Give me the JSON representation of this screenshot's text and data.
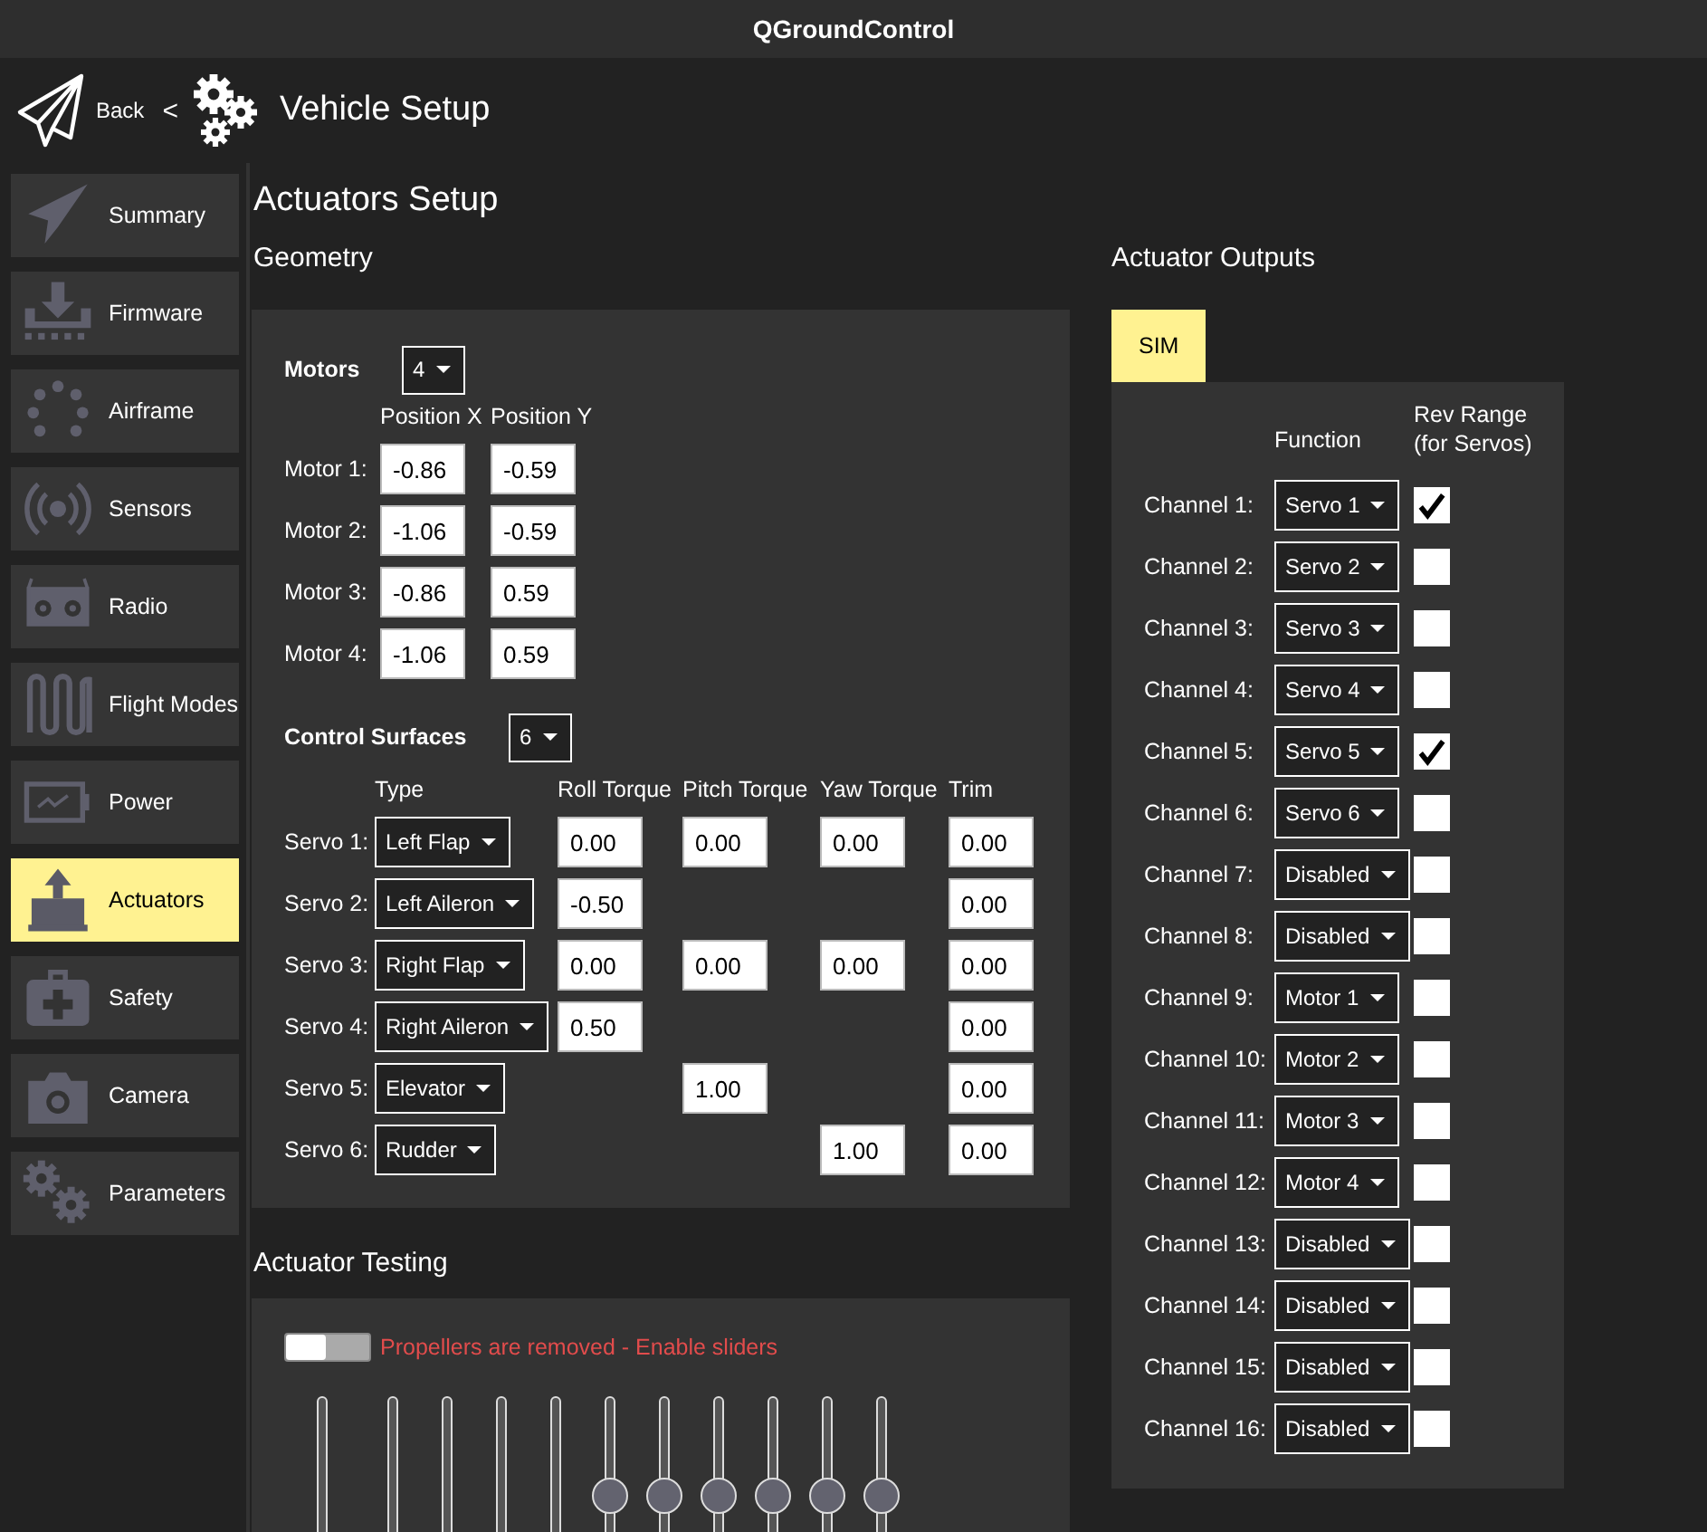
{
  "window": {
    "title": "QGroundControl"
  },
  "header": {
    "back": "Back",
    "separator": "<",
    "title": "Vehicle Setup"
  },
  "sidebar": {
    "items": [
      {
        "label": "Summary",
        "selected": false
      },
      {
        "label": "Firmware",
        "selected": false
      },
      {
        "label": "Airframe",
        "selected": false
      },
      {
        "label": "Sensors",
        "selected": false
      },
      {
        "label": "Radio",
        "selected": false
      },
      {
        "label": "Flight Modes",
        "selected": false
      },
      {
        "label": "Power",
        "selected": false
      },
      {
        "label": "Actuators",
        "selected": true
      },
      {
        "label": "Safety",
        "selected": false
      },
      {
        "label": "Camera",
        "selected": false
      },
      {
        "label": "Parameters",
        "selected": false
      }
    ]
  },
  "page_title": "Actuators Setup",
  "geometry": {
    "title": "Geometry",
    "motors": {
      "label": "Motors",
      "count": "4",
      "columns": [
        "Position X",
        "Position Y"
      ],
      "rows": [
        {
          "label": "Motor 1:",
          "values": [
            "-0.86",
            "-0.59"
          ]
        },
        {
          "label": "Motor 2:",
          "values": [
            "-1.06",
            "-0.59"
          ]
        },
        {
          "label": "Motor 3:",
          "values": [
            "-0.86",
            "0.59"
          ]
        },
        {
          "label": "Motor 4:",
          "values": [
            "-1.06",
            "0.59"
          ]
        }
      ]
    },
    "control_surfaces": {
      "label": "Control Surfaces",
      "count": "6",
      "columns": [
        "Type",
        "Roll Torque",
        "Pitch Torque",
        "Yaw Torque",
        "Trim"
      ],
      "rows": [
        {
          "label": "Servo 1:",
          "type": "Left Flap",
          "roll": "0.00",
          "pitch": "0.00",
          "yaw": "0.00",
          "trim": "0.00"
        },
        {
          "label": "Servo 2:",
          "type": "Left Aileron",
          "roll": "-0.50",
          "trim": "0.00"
        },
        {
          "label": "Servo 3:",
          "type": "Right Flap",
          "roll": "0.00",
          "pitch": "0.00",
          "yaw": "0.00",
          "trim": "0.00"
        },
        {
          "label": "Servo 4:",
          "type": "Right Aileron",
          "roll": "0.50",
          "trim": "0.00"
        },
        {
          "label": "Servo 5:",
          "type": "Elevator",
          "pitch": "1.00",
          "trim": "0.00"
        },
        {
          "label": "Servo 6:",
          "type": "Rudder",
          "yaw": "1.00",
          "trim": "0.00"
        }
      ]
    }
  },
  "testing": {
    "title": "Actuator Testing",
    "propellers_removed": false,
    "switch_label": "Propellers are removed - Enable sliders",
    "sliders": [
      {
        "kind": "motor"
      },
      {
        "kind": "motor"
      },
      {
        "kind": "motor"
      },
      {
        "kind": "motor"
      },
      {
        "kind": "motor"
      },
      {
        "kind": "servo"
      },
      {
        "kind": "servo"
      },
      {
        "kind": "servo"
      },
      {
        "kind": "servo"
      },
      {
        "kind": "servo"
      },
      {
        "kind": "servo"
      }
    ]
  },
  "outputs": {
    "title": "Actuator Outputs",
    "tabs": [
      {
        "label": "SIM",
        "selected": true
      }
    ],
    "columns": [
      "Function",
      "Rev Range (for Servos)"
    ],
    "channels": [
      {
        "label": "Channel 1:",
        "function": "Servo 1",
        "rev_range": true
      },
      {
        "label": "Channel 2:",
        "function": "Servo 2",
        "rev_range": false
      },
      {
        "label": "Channel 3:",
        "function": "Servo 3",
        "rev_range": false
      },
      {
        "label": "Channel 4:",
        "function": "Servo 4",
        "rev_range": false
      },
      {
        "label": "Channel 5:",
        "function": "Servo 5",
        "rev_range": true
      },
      {
        "label": "Channel 6:",
        "function": "Servo 6",
        "rev_range": false
      },
      {
        "label": "Channel 7:",
        "function": "Disabled",
        "rev_range": false
      },
      {
        "label": "Channel 8:",
        "function": "Disabled",
        "rev_range": false
      },
      {
        "label": "Channel 9:",
        "function": "Motor 1",
        "rev_range": false
      },
      {
        "label": "Channel 10:",
        "function": "Motor 2",
        "rev_range": false
      },
      {
        "label": "Channel 11:",
        "function": "Motor 3",
        "rev_range": false
      },
      {
        "label": "Channel 12:",
        "function": "Motor 4",
        "rev_range": false
      },
      {
        "label": "Channel 13:",
        "function": "Disabled",
        "rev_range": false
      },
      {
        "label": "Channel 14:",
        "function": "Disabled",
        "rev_range": false
      },
      {
        "label": "Channel 15:",
        "function": "Disabled",
        "rev_range": false
      },
      {
        "label": "Channel 16:",
        "function": "Disabled",
        "rev_range": false
      }
    ]
  }
}
